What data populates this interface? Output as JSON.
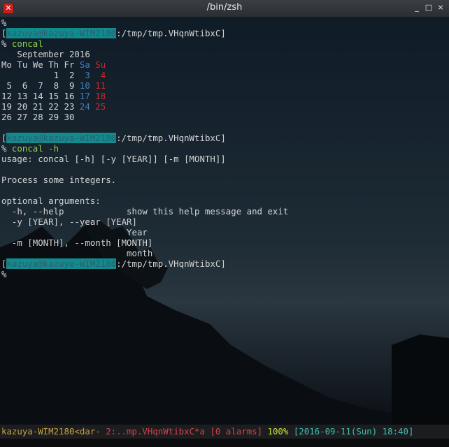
{
  "window": {
    "title": "/bin/zsh",
    "icon": "x-terminal-icon",
    "buttons": {
      "minimize": "_",
      "maximize": "□",
      "close": "×"
    }
  },
  "terminal": {
    "blocks": [
      {
        "type": "text",
        "text": "%"
      },
      {
        "type": "prompt",
        "host": "kazuya@kazuya-WIM2180",
        "path": ":/tmp/tmp.VHqnWtibxC]"
      },
      {
        "type": "command",
        "text": "concal"
      },
      {
        "type": "text",
        "text": "   September 2016"
      },
      {
        "type": "weekdays",
        "cells": [
          "Mo",
          "Tu",
          "We",
          "Th",
          "Fr",
          "Sa",
          "Su"
        ]
      },
      {
        "type": "week",
        "cells": [
          "",
          "",
          "",
          "1",
          "2",
          "3",
          "4"
        ]
      },
      {
        "type": "week",
        "cells": [
          "5",
          "6",
          "7",
          "8",
          "9",
          "10",
          "11"
        ]
      },
      {
        "type": "week",
        "cells": [
          "12",
          "13",
          "14",
          "15",
          "16",
          "17",
          "18"
        ]
      },
      {
        "type": "week",
        "cells": [
          "19",
          "20",
          "21",
          "22",
          "23",
          "24",
          "25"
        ]
      },
      {
        "type": "week",
        "cells": [
          "26",
          "27",
          "28",
          "29",
          "30",
          "",
          ""
        ]
      },
      {
        "type": "text",
        "text": ""
      },
      {
        "type": "prompt",
        "host": "kazuya@kazuya-WIM2180",
        "path": ":/tmp/tmp.VHqnWtibxC]"
      },
      {
        "type": "command",
        "text": "concal -h"
      },
      {
        "type": "text",
        "text": "usage: concal [-h] [-y [YEAR]] [-m [MONTH]]"
      },
      {
        "type": "text",
        "text": ""
      },
      {
        "type": "text",
        "text": "Process some integers."
      },
      {
        "type": "text",
        "text": ""
      },
      {
        "type": "text",
        "text": "optional arguments:"
      },
      {
        "type": "text",
        "text": "  -h, --help            show this help message and exit"
      },
      {
        "type": "text",
        "text": "  -y [YEAR], --year [YEAR]"
      },
      {
        "type": "text",
        "text": "                        Year"
      },
      {
        "type": "text",
        "text": "  -m [MONTH], --month [MONTH]"
      },
      {
        "type": "text",
        "text": "                        month"
      },
      {
        "type": "prompt",
        "host": "kazuya@kazuya-WIM2180",
        "path": ":/tmp/tmp.VHqnWtibxC]"
      },
      {
        "type": "text",
        "text": "%"
      }
    ]
  },
  "statusbar": {
    "host": "kazuya-WIM2180",
    "lt": "<",
    "prev_window": "dar-",
    "current_window": "2:..mp.VHqnWtibxC*a",
    "alarms": "[0 alarms]",
    "battery": "100%",
    "clock": "[2016-09-11(Sun) 18:40]"
  },
  "colors": {
    "prompt_highlight": "#118c8c",
    "command": "#8fd14f",
    "saturday": "#3f7fbf",
    "sunday": "#cc2a2a",
    "text": "#d4d4d4"
  }
}
